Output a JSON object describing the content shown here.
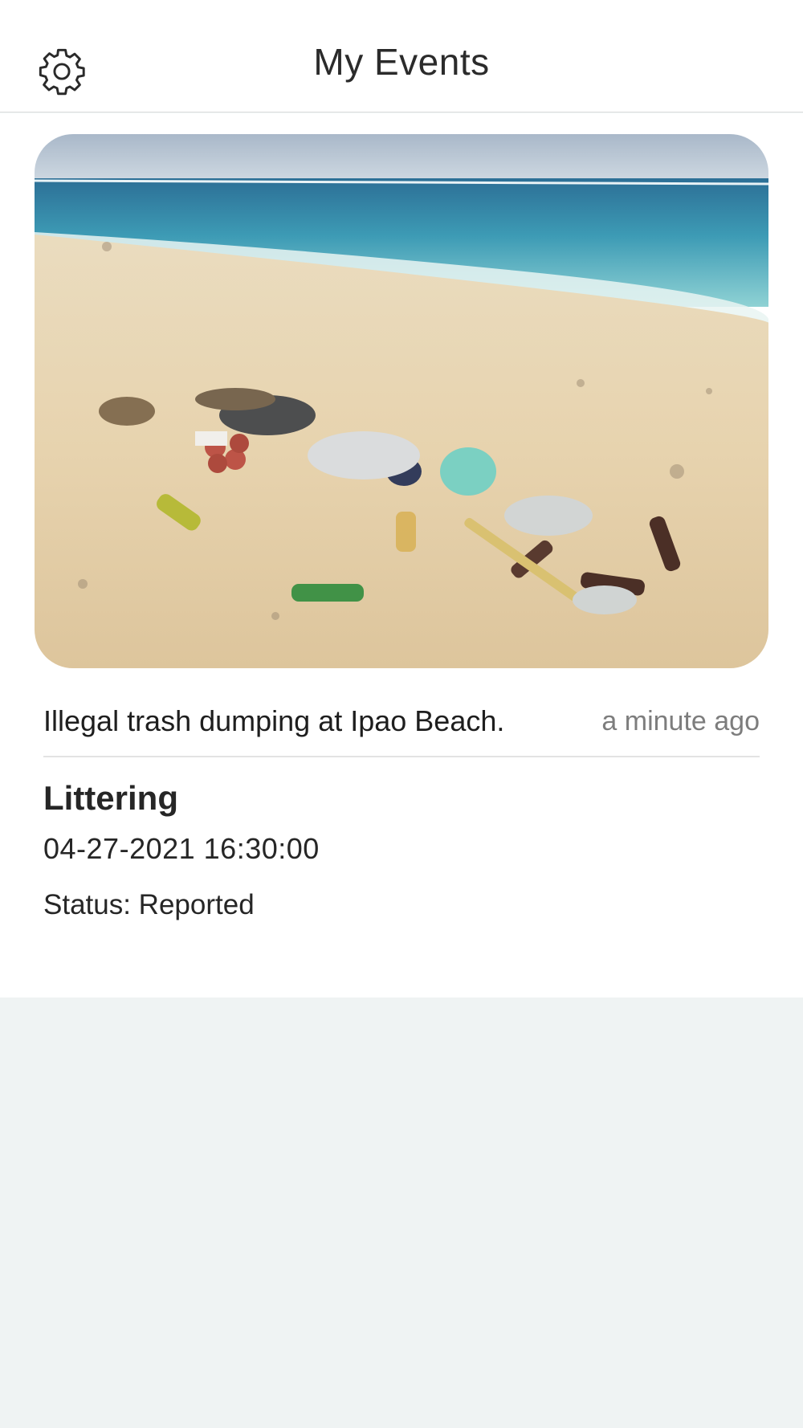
{
  "header": {
    "title": "My Events",
    "settings_icon": "gear-icon"
  },
  "events": [
    {
      "image_alt": "Beach with trash",
      "description": "Illegal trash dumping at Ipao Beach.",
      "time_ago": "a minute ago",
      "category": "Littering",
      "datetime": "04-27-2021 16:30:00",
      "status": "Status: Reported"
    }
  ],
  "colors": {
    "background": "#eff3f3",
    "card": "#ffffff",
    "text": "#262626",
    "muted": "#7d7d7d"
  }
}
